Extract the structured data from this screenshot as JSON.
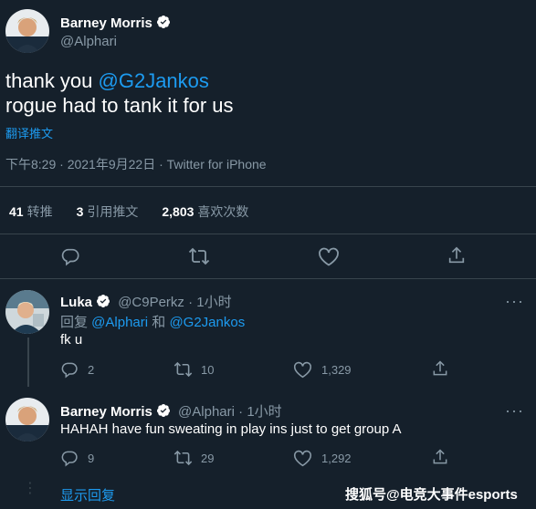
{
  "main_tweet": {
    "author_name": "Barney Morris",
    "author_handle": "@Alphari",
    "text_line1_prefix": "thank you ",
    "text_line1_mention": "@G2Jankos",
    "text_line2": "rogue had to tank it for us",
    "translate": "翻译推文",
    "timestamp": "下午8:29 · 2021年9月22日 · Twitter for iPhone",
    "stats": {
      "retweets_num": "41",
      "retweets_label": "转推",
      "quotes_num": "3",
      "quotes_label": "引用推文",
      "likes_num": "2,803",
      "likes_label": "喜欢次数"
    }
  },
  "replies": [
    {
      "author_name": "Luka",
      "author_handle": "@C9Perkz",
      "time": "1小时",
      "reply_prefix": "回复 ",
      "reply_to_1": "@Alphari",
      "reply_and": " 和 ",
      "reply_to_2": "@G2Jankos",
      "text": "fk u",
      "replies_count": "2",
      "retweets_count": "10",
      "likes_count": "1,329"
    },
    {
      "author_name": "Barney Morris",
      "author_handle": "@Alphari",
      "time": "1小时",
      "text": "HAHAH have fun sweating in play ins just to get group A",
      "replies_count": "9",
      "retweets_count": "29",
      "likes_count": "1,292"
    }
  ],
  "show_replies": "显示回复",
  "watermark": "搜狐号@电竞大事件esports",
  "colors": {
    "background": "#15202b",
    "accent": "#1d9bf0",
    "muted": "#8899a6",
    "divider": "#38444d"
  }
}
